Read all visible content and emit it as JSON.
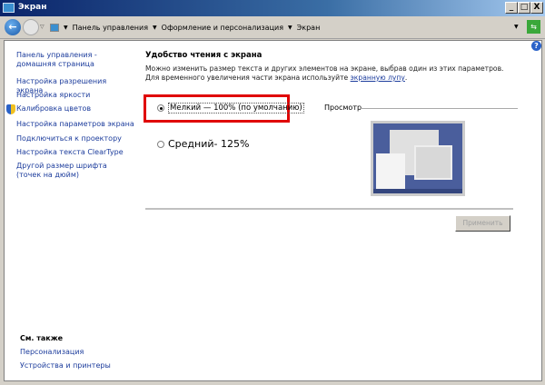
{
  "window": {
    "title": "Экран",
    "minimize": "_",
    "maximize": "□",
    "close": "X"
  },
  "breadcrumb": [
    "Панель управления",
    "Оформление и персонализация",
    "Экран"
  ],
  "sidebar": {
    "items": [
      {
        "label": "Панель управления - домашняя страница"
      },
      {
        "label": "Настройка разрешения экрана"
      },
      {
        "label": "Настройка яркости"
      },
      {
        "label": "Калибровка цветов",
        "icon": "shield-icon"
      },
      {
        "label": "Настройка параметров экрана"
      },
      {
        "label": "Подключиться к проектору"
      },
      {
        "label": "Настройка текста ClearType"
      },
      {
        "label": "Другой размер шрифта (точек на дюйм)"
      }
    ],
    "see_also": {
      "title": "См. также",
      "items": [
        "Персонализация",
        "Устройства и принтеры"
      ]
    }
  },
  "main": {
    "heading": "Удобство чтения с экрана",
    "desc": "Можно изменить размер текста и других элементов на экране, выбрав один из этих параметров. Для временного увеличения части экрана используйте",
    "desc_link": "экранную лупу",
    "desc_end": ".",
    "options": [
      {
        "label": "Мелкий — 100% (по умолчанию)",
        "selected": true
      },
      {
        "label": "Средний- 125%",
        "selected": false
      }
    ],
    "preview_label": "Просмотр",
    "apply": "Применить"
  },
  "colors": {
    "highlight": "#e00000",
    "link": "#1c3c9c"
  }
}
